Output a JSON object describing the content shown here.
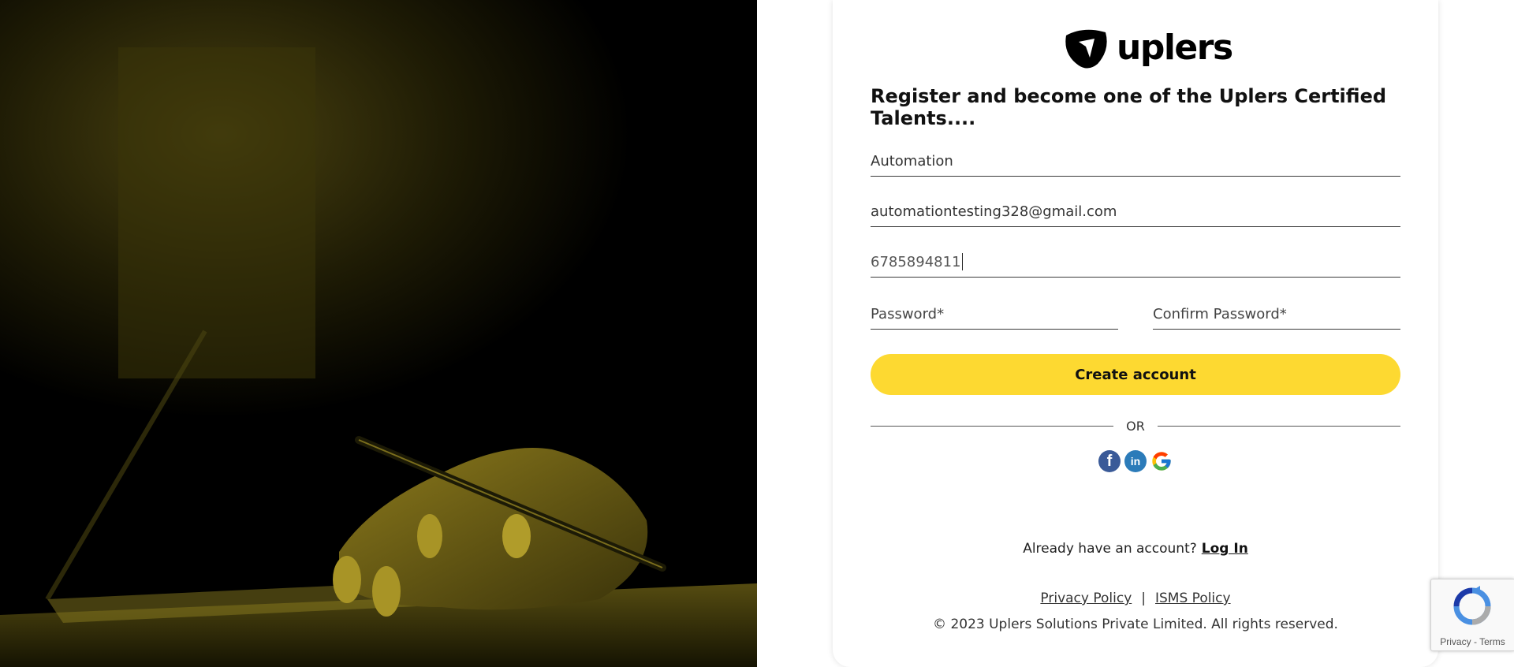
{
  "brand": {
    "name": "uplers",
    "accent": "#fdd931"
  },
  "headline": "Register and become one of the Uplers Certified Talents....",
  "form": {
    "name_value": "Automation",
    "email_value": "automationtesting328@gmail.com",
    "phone_value": "6785894811",
    "password_placeholder": "Password*",
    "confirm_password_placeholder": "Confirm Password*",
    "create_button": "Create account"
  },
  "divider_text": "OR",
  "socials": [
    {
      "icon": "facebook-icon",
      "glyph": "f"
    },
    {
      "icon": "linkedin-icon",
      "glyph": "in"
    },
    {
      "icon": "google-icon"
    }
  ],
  "login": {
    "prompt": "Already have an account?",
    "link": "Log In"
  },
  "footer": {
    "privacy": "Privacy Policy",
    "separator": "|",
    "isms": "ISMS Policy",
    "copyright": "© 2023 Uplers Solutions Private Limited. All rights reserved."
  },
  "recaptcha": {
    "privacy": "Privacy",
    "dash": " - ",
    "terms": "Terms"
  }
}
